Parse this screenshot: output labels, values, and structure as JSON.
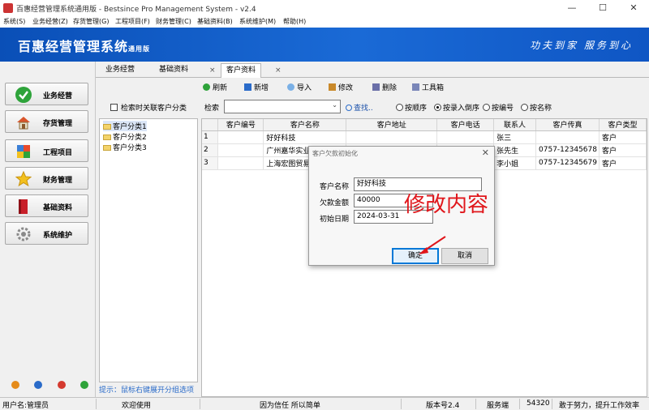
{
  "window": {
    "title": "百惠经营管理系统通用版 - Bestsince Pro Management System - v2.4",
    "controls": {
      "minimize": "—",
      "maximize": "☐",
      "close": "✕"
    }
  },
  "menubar": {
    "items": [
      {
        "label": "系统(S)"
      },
      {
        "label": "业务经营(Z)"
      },
      {
        "label": "存货管理(G)"
      },
      {
        "label": "工程项目(F)"
      },
      {
        "label": "财务管理(C)"
      },
      {
        "label": "基础资料(B)"
      },
      {
        "label": "系统维护(M)"
      },
      {
        "label": "帮助(H)"
      }
    ]
  },
  "banner": {
    "app_title": "百惠经营管理系统",
    "app_edition": "通用版",
    "slogan": "功夫到家 服务到心"
  },
  "leftnav": {
    "items": [
      {
        "label": "业务经营",
        "icon": "check-icon",
        "color": "#2ea33a"
      },
      {
        "label": "存货管理",
        "icon": "house-icon",
        "color": "#d9552b"
      },
      {
        "label": "工程项目",
        "icon": "cube-icon",
        "color": "#3a7fd6"
      },
      {
        "label": "财务管理",
        "icon": "star-icon",
        "color": "#f2c01e"
      },
      {
        "label": "基础资料",
        "icon": "book-icon",
        "color": "#c8202a"
      },
      {
        "label": "系统维护",
        "icon": "gear-icon",
        "color": "#8a8a8a"
      }
    ]
  },
  "tabs": [
    {
      "label": "业务经营"
    },
    {
      "label": "基础资料"
    },
    {
      "label": "客户资料",
      "active": true
    }
  ],
  "tab_close_glyph": "×",
  "toolbar": {
    "refresh": "刷新",
    "add": "新增",
    "import": "导入",
    "edit": "修改",
    "delete": "删除",
    "tools": "工具箱"
  },
  "filter": {
    "checkbox_label": "检索时关联客户分类",
    "search_label": "检索",
    "search_value": "",
    "search_button": "查找..",
    "sort_options": [
      {
        "label": "按顺序",
        "selected": false
      },
      {
        "label": "按录入倒序",
        "selected": true
      },
      {
        "label": "按编号",
        "selected": false
      },
      {
        "label": "按名称",
        "selected": false
      }
    ]
  },
  "tree": {
    "items": [
      {
        "label": "客户分类1",
        "selected": true
      },
      {
        "label": "客户分类2"
      },
      {
        "label": "客户分类3"
      }
    ],
    "tip": "提示：鼠标右键展开分组选项"
  },
  "grid": {
    "columns": [
      "",
      "客户编号",
      "客户名称",
      "客户地址",
      "客户电话",
      "联系人",
      "客户传真",
      "客户类型"
    ],
    "rows": [
      {
        "n": "1",
        "code": "",
        "name": "好好科技",
        "address": "",
        "phone": "",
        "contact": "张三",
        "fax": "",
        "type": "客户"
      },
      {
        "n": "2",
        "code": "",
        "name": "广州嘉华实业有限公司",
        "address": "",
        "phone": "",
        "contact": "张先生",
        "fax": "0757-12345678",
        "type": "客户"
      },
      {
        "n": "3",
        "code": "",
        "name": "上海宏图贸易",
        "address": "",
        "phone": "",
        "contact": "李小姐",
        "fax": "0757-12345679",
        "type": "客户"
      }
    ]
  },
  "dialog": {
    "title": "客户欠款初始化",
    "close": "✕",
    "customer_name_label": "客户名称",
    "customer_name_value": "好好科技",
    "amount_label": "欠款金额",
    "amount_value": "40000",
    "date_label": "初始日期",
    "date_value": "2024-03-31",
    "ok_label": "确定",
    "cancel_label": "取消"
  },
  "annotation": {
    "text": "修改内容",
    "color": "#e0161b"
  },
  "statusbar": {
    "user": "用户名:管理员",
    "welcome": "欢迎使用",
    "motto": "因为信任 所以简单",
    "version": "版本号2.4",
    "server": "服务端",
    "port": "54320",
    "slogan": "敢于努力，提升工作效率"
  }
}
